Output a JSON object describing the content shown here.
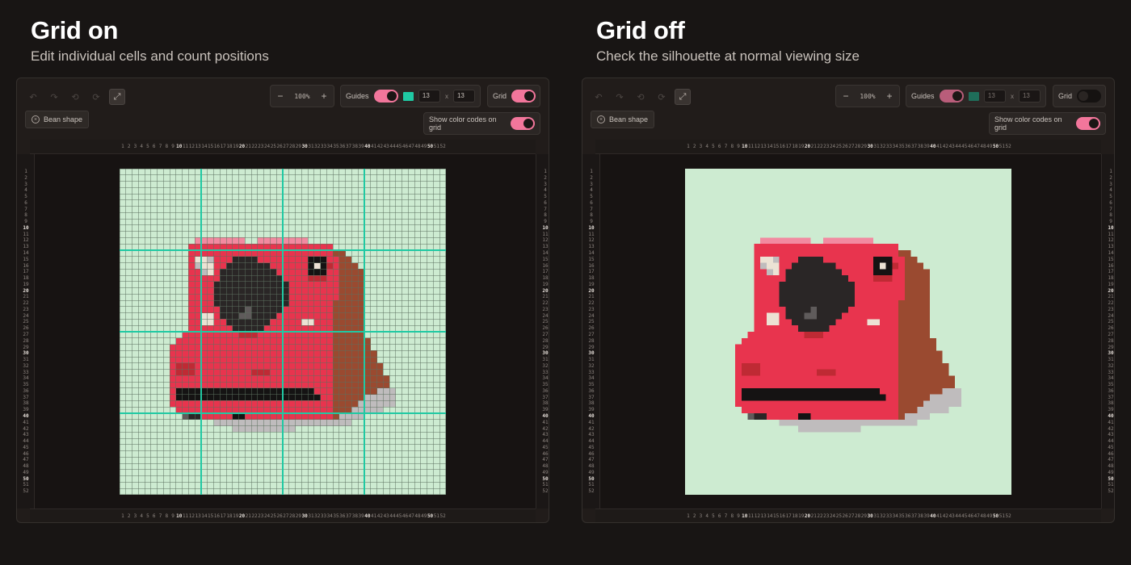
{
  "left": {
    "title": "Grid on",
    "subtitle": "Edit individual cells and count positions",
    "toolbar": {
      "zoom_value": "100%",
      "guides_label": "Guides",
      "cols": "13",
      "rows": "13",
      "times": "x",
      "grid_label": "Grid",
      "color_codes_label": "Show color codes on grid",
      "bean_label": "Bean shape",
      "guides_on": true,
      "grid_on": true,
      "color_codes_on": true
    }
  },
  "right": {
    "title": "Grid off",
    "subtitle": "Check the silhouette at normal viewing size",
    "toolbar": {
      "zoom_value": "100%",
      "guides_label": "Guides",
      "cols": "13",
      "rows": "13",
      "times": "x",
      "grid_label": "Grid",
      "color_codes_label": "Show color codes on grid",
      "bean_label": "Bean shape",
      "guides_on": true,
      "grid_on": false,
      "color_codes_on": true
    }
  },
  "icons": {
    "undo": "undo-icon",
    "redo": "redo-icon",
    "rotate_left": "rotate-left-icon",
    "rotate_right": "rotate-right-icon",
    "expand": "expand-icon",
    "circle": "circle-icon"
  },
  "colors": {
    "background": "#181514",
    "canvas_bg": "#cdebd1",
    "toggle_on": "#f2769b",
    "guide_color": "#1fc9a3",
    "grid_line": "#5c6f5e"
  },
  "ruler": {
    "count": 52
  },
  "guides": {
    "every": 13
  },
  "pixel_art": {
    "size": 52,
    "subject": "red instant camera",
    "palette": {
      "R": "#e8344e",
      "D": "#bf2a34",
      "P": "#f28aa0",
      "B": "#2a2626",
      "K": "#151313",
      "G": "#5f5b5b",
      "L": "#bfbcbd",
      "W": "#ece2d4",
      "N": "#9a4a30",
      "M": "#c05a3c"
    },
    "rows": [
      "",
      "",
      "",
      "",
      "",
      "",
      "",
      "",
      "",
      "",
      "",
      "............PPPPPPPP..PPPPPPPP",
      "...........RRRRRRRRRRRRRRRRRRRRRRR",
      "...........RRRRRRRRRRRRRRRRRRRRRRRNN",
      "...........RWWLRRRBBBBRRRRRRRRKKKRRNN",
      "...........RLWWRRBBBBBBBRRRRRRKWKDRNNN",
      "...........RRLWRBBBBBBBBBRRRRRKKKRRNNNN",
      "...........RRRRRBBBBBBBBBBRRRRDDDRRNNNN",
      "...........RRRRBBBBBBBBBBBBRRRRRRRRNNNN",
      "...........RRRRBBBBBBBBBBBBRRRRRRRRNNNN",
      "...........RRRRBBBBBBBBBBBBRRRRRRRRNNNN",
      "...........RRRRBBBBBBBBBBBBRRRRRRRNNNNN",
      "...........RRRRRBBBBGBBBBBRRRRRRRRNNNNN",
      "...........RRWWRBBBGGBBBBRRRRRRRRRNNNNN",
      "...........RRWWRRBBBBBBBRRRRRWWRRRNNNNN",
      "...........RRRRRRRBBBBBRRRRRRRRRRRNNNNN",
      "..........RRRRRRRRRDDDRRRRRRRRRRRRNNNNN",
      ".........RRRRRRRRRRRRRRRRRRRRRRRRRNNNNNN",
      "........RRRRRRRRRRRRRRRRRRRRRRRRRRNNNNNN",
      "........RRRRRRRRRRRRRRRRRRRRRRRRRRNNNNNNN",
      "........RRRRRRRRRRRRRRRRRRRRRRRRRRNNNNNNN",
      "........RDDDRRRRRRRRRRRRRRRRRRRRRRNNNNNNNN",
      "........RDDDRRRRRRRRRDDDRRRRRRRRRRNNNNNNNN",
      "........RRRRRRRRRRRRRRRRRRRRRRRRRRNNNNNNNNN",
      "........RRRRRRRRRRRRRRRRRRRRRRRRRRNNNNNNNNN",
      "........RKKKKKKKKKKKKKKKKKKKKKKRRRNNNNNNNLLL",
      "........RKKKKKKKKKKKKKKKKKKKKKKKRRNNNNNLLLLL",
      "........RRRRRRRRRRRRRRRRRRRRRRRRRRNNNNLLLLLL",
      ".........RRRRRRRRRRRRRRRRRRRRRRRRRNNNLLLLL",
      "..........GBBRRRRRKKRRRRRRRRRRRRRRNLLLL",
      "...............LLLLLLLLLLLLLLLLLLLLLL",
      "..................LLLLLLLLLL"
    ]
  }
}
